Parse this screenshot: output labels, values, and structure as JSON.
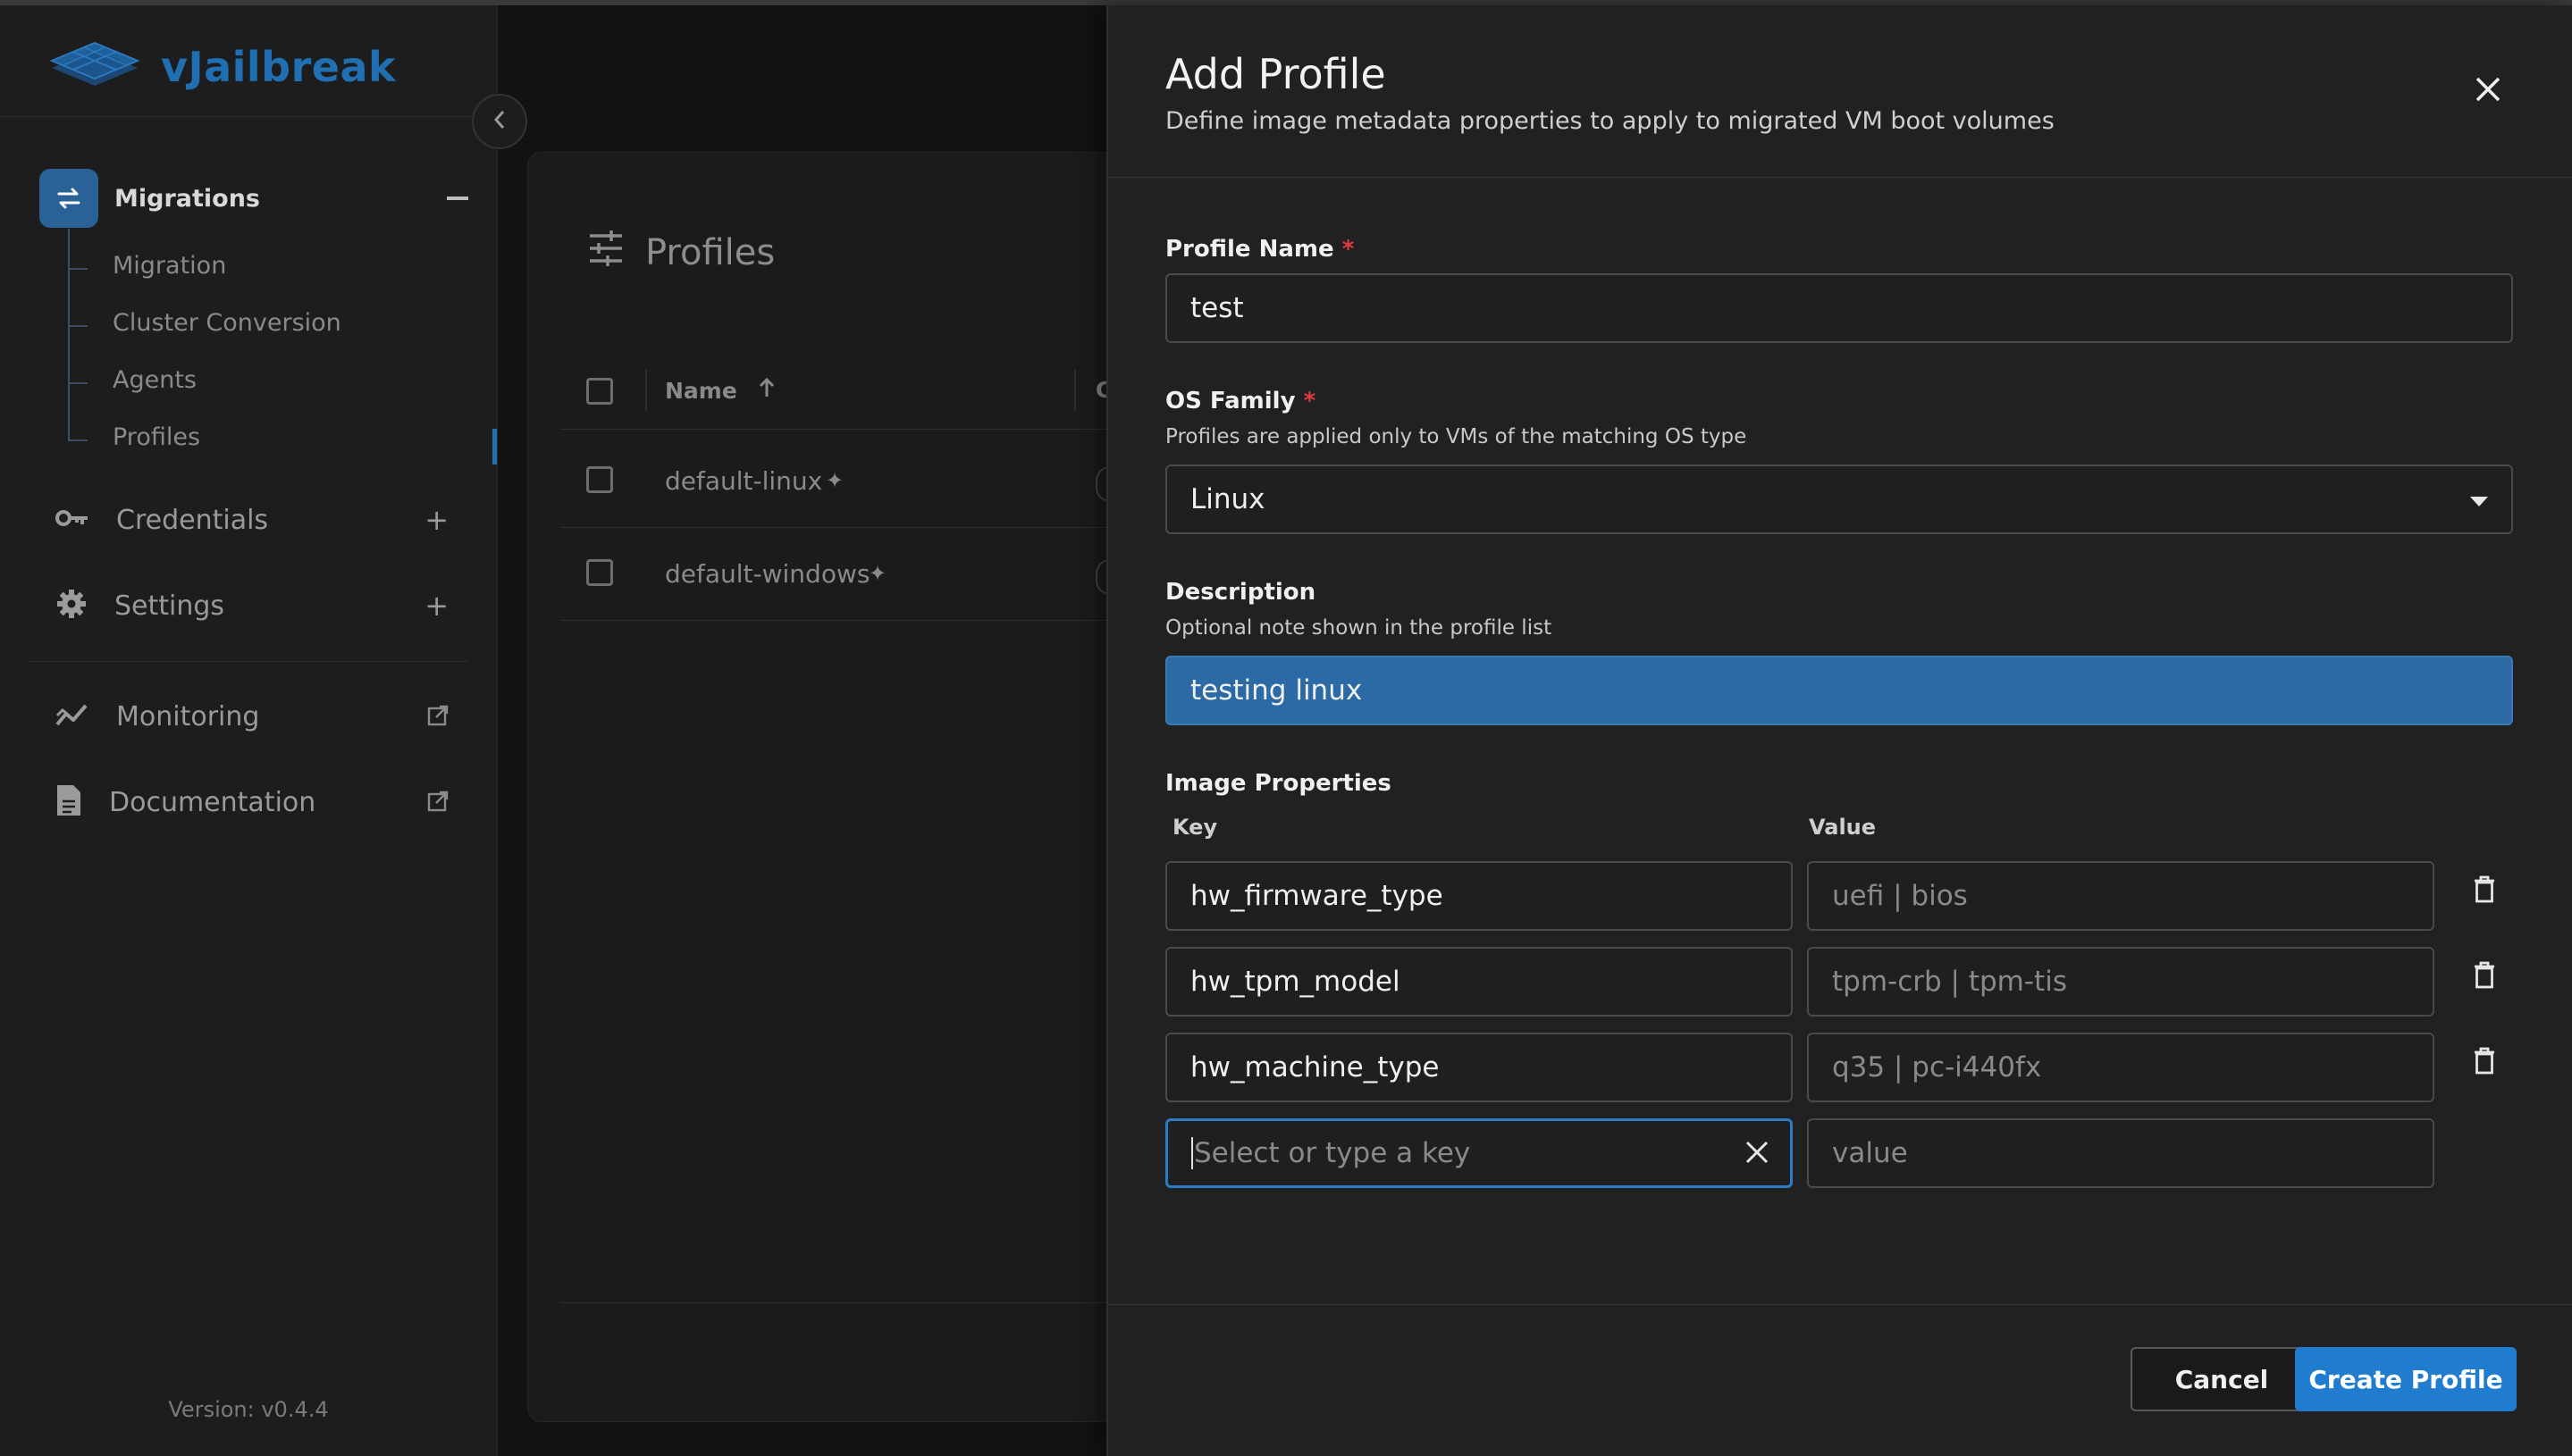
{
  "app": {
    "brand": "vJailbreak",
    "version": "Version: v0.4.4"
  },
  "sidebar": {
    "group": {
      "label": "Migrations",
      "icon": "swap-arrows-icon"
    },
    "sub_items": [
      "Migration",
      "Cluster Conversion",
      "Agents",
      "Profiles"
    ],
    "items": [
      {
        "label": "Credentials",
        "icon": "key-icon",
        "trail": "+"
      },
      {
        "label": "Settings",
        "icon": "gear-icon",
        "trail": "+"
      },
      {
        "label": "Monitoring",
        "icon": "chart-trend-icon",
        "trail": "external-link-icon"
      },
      {
        "label": "Documentation",
        "icon": "document-icon",
        "trail": "external-link-icon"
      }
    ]
  },
  "main": {
    "title": "Profiles",
    "table": {
      "col_name": "Name",
      "col_second_partial": "C",
      "rows": [
        "default-linux",
        "default-windows"
      ]
    }
  },
  "drawer": {
    "title": "Add Profile",
    "subtitle": "Define image metadata properties to apply to migrated VM boot volumes",
    "profile_name": {
      "label": "Profile Name",
      "required": "*",
      "value": "test"
    },
    "os_family": {
      "label": "OS Family",
      "required": "*",
      "help": "Profiles are applied only to VMs of the matching OS type",
      "value": "Linux"
    },
    "description": {
      "label": "Description",
      "help": "Optional note shown in the profile list",
      "value": "testing linux"
    },
    "image_properties": {
      "label": "Image Properties",
      "key_header": "Key",
      "value_header": "Value",
      "rows": [
        {
          "key": "hw_firmware_type",
          "value_placeholder": "uefi | bios"
        },
        {
          "key": "hw_tpm_model",
          "value_placeholder": "tpm-crb | tpm-tis"
        },
        {
          "key": "hw_machine_type",
          "value_placeholder": "q35 | pc-i440fx"
        }
      ],
      "new_row": {
        "key_placeholder": "Select or type a key",
        "value_placeholder": "value"
      }
    },
    "cancel_label": "Cancel",
    "create_label": "Create Profile"
  },
  "colors": {
    "accent": "#1f7ccf",
    "brand": "#1f6fb2",
    "selection": "#2b6aa4",
    "required": "#e23b3b"
  }
}
